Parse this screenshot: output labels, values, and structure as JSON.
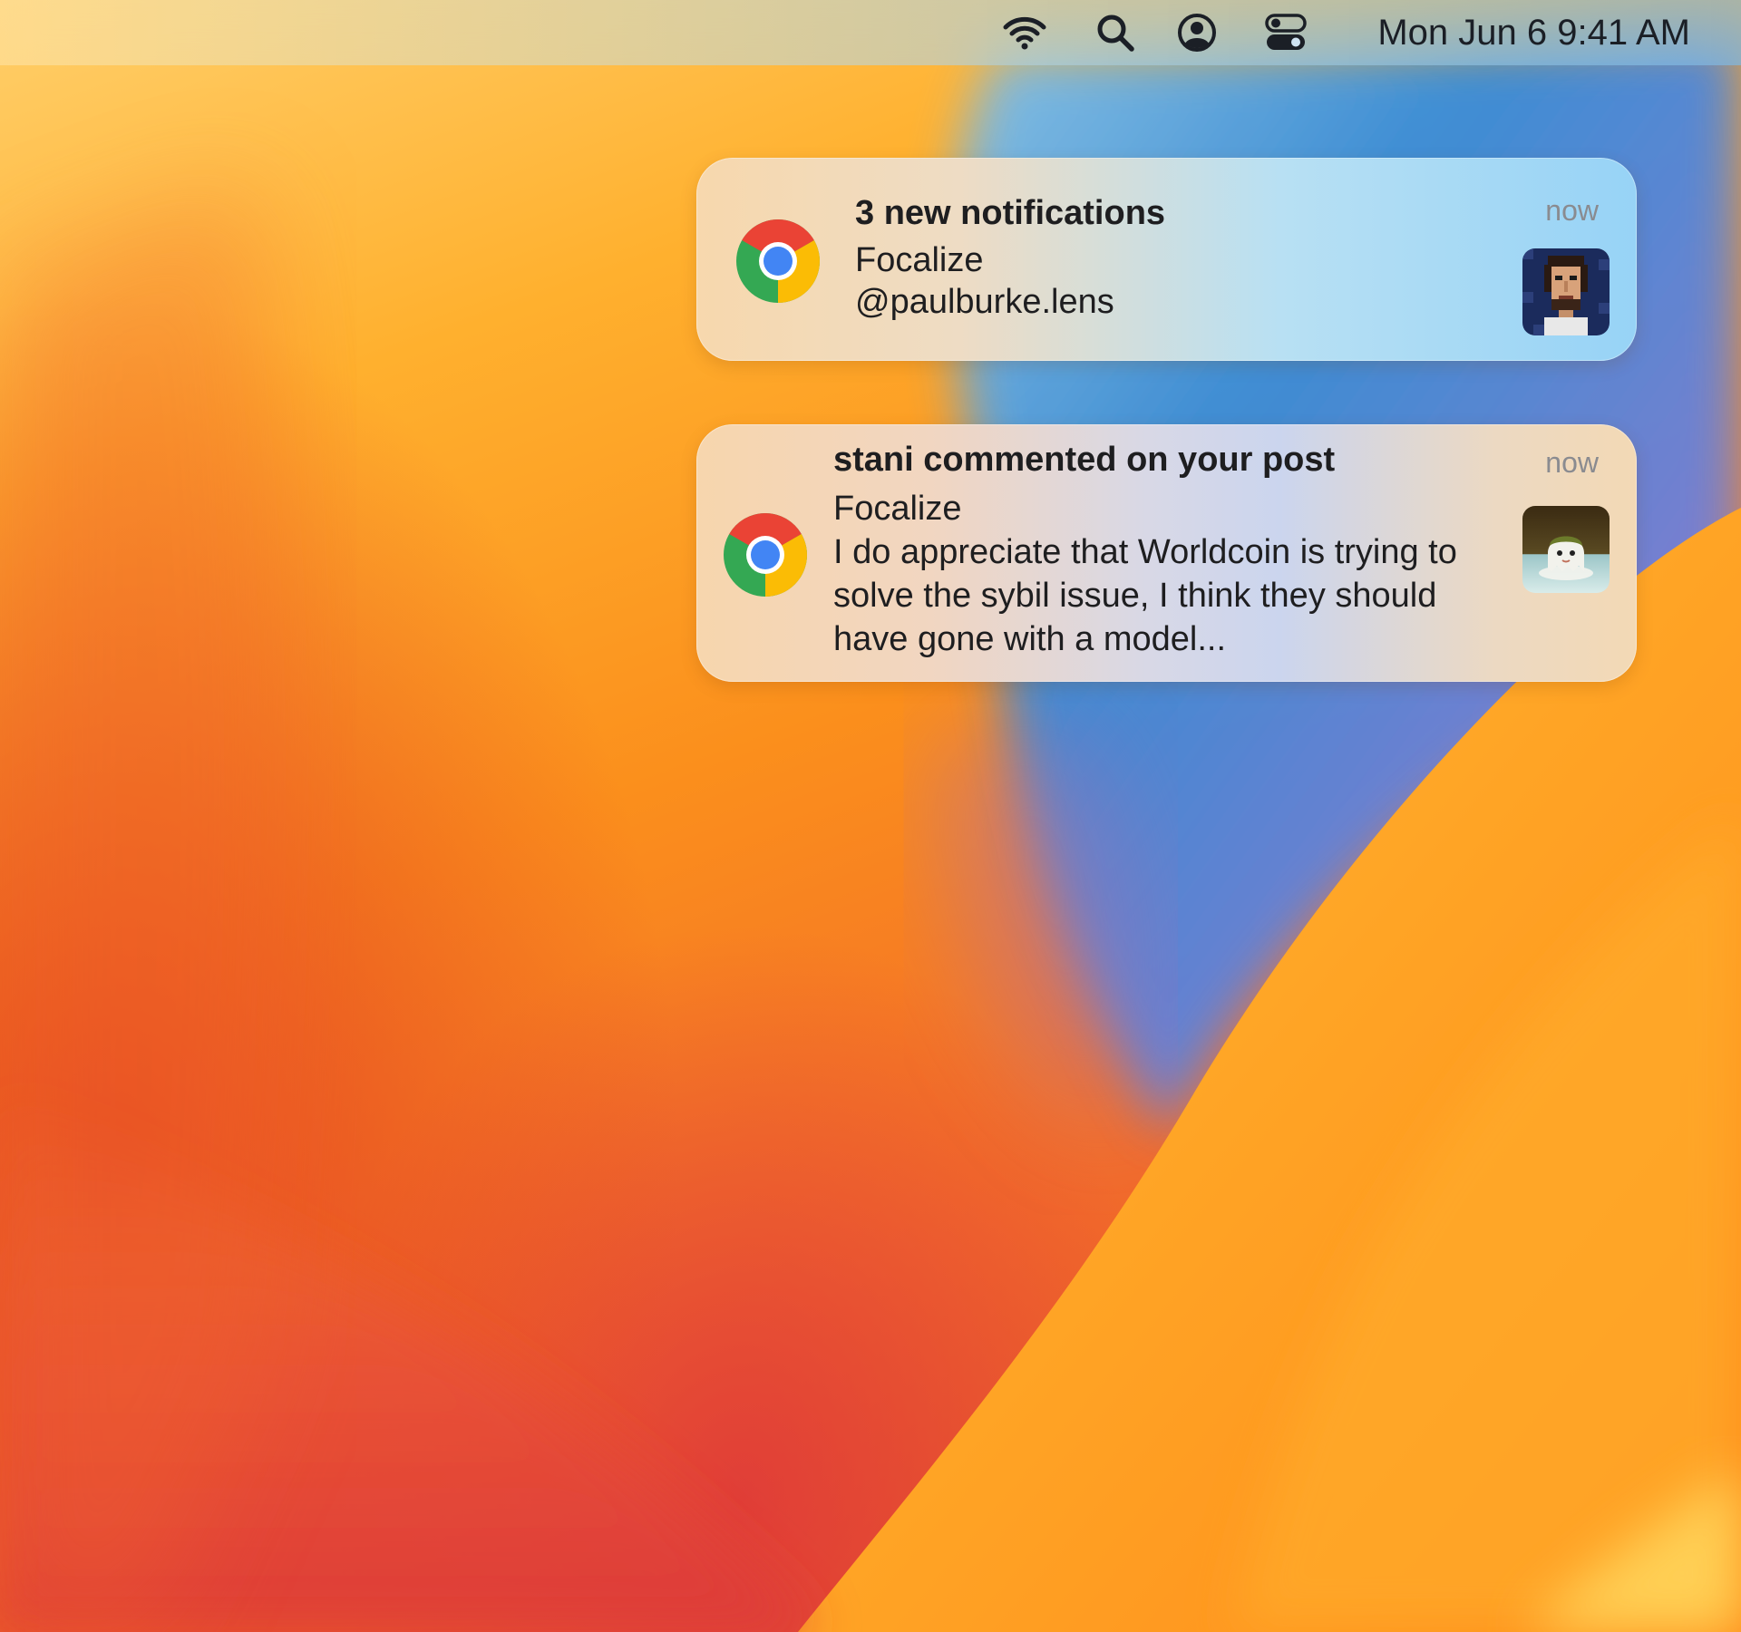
{
  "menubar": {
    "icons": [
      "wifi-icon",
      "search-icon",
      "user-account-icon",
      "control-center-icon"
    ],
    "clock": "Mon Jun 6  9:41 AM"
  },
  "notifications": [
    {
      "app_icon": "chrome-icon",
      "title": "3 new notifications",
      "subtitle": "Focalize",
      "body": "@paulburke.lens",
      "time": "now",
      "thumbnail": "pixel-art-avatar"
    },
    {
      "app_icon": "chrome-icon",
      "title": "stani commented on your post",
      "subtitle": "Focalize",
      "body": "I do appreciate that Worldcoin is trying to solve the sybil issue, I think they should have gone with a model...",
      "time": "now",
      "thumbnail": "ghost-character-avatar"
    }
  ],
  "colors": {
    "wallpaper_orange": "#fb8f1c",
    "wallpaper_red": "#e04a2a",
    "wallpaper_blue": "#1f7fe0",
    "notification_text": "#1e1e20",
    "timestamp": "#8a8b90"
  }
}
